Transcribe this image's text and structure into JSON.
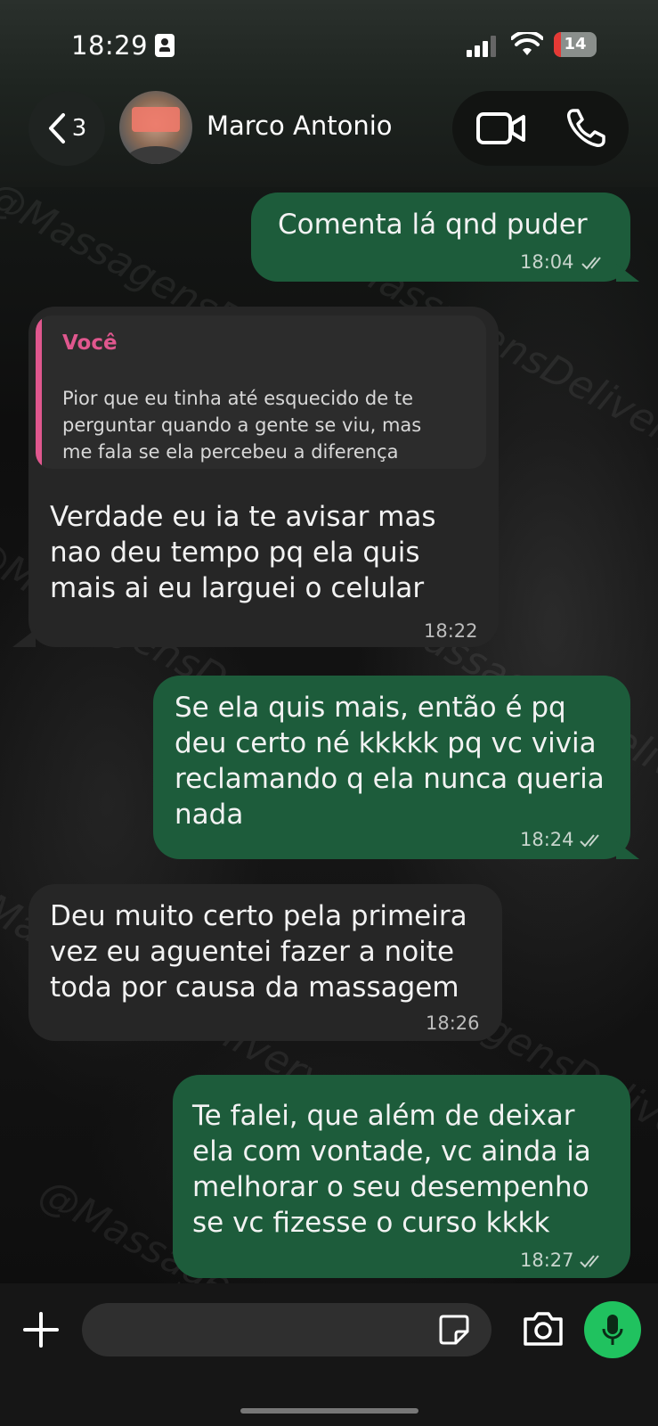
{
  "status_bar": {
    "time": "18:29",
    "battery_level": "14",
    "battery_color": "#e53935"
  },
  "header": {
    "back_count": "3",
    "contact_name": "Marco Antonio",
    "icons": [
      "chevron-left-icon",
      "video-call-icon",
      "phone-icon"
    ]
  },
  "messages": [
    {
      "direction": "out",
      "lines": [
        "Comenta lá qnd puder"
      ],
      "time": "18:04",
      "status": "read"
    },
    {
      "direction": "in",
      "reply_to": {
        "author": "Você",
        "lines": [
          "Pior que eu tinha até esquecido de te",
          "perguntar quando a gente se viu, mas",
          "me fala se ela percebeu a diferença"
        ]
      },
      "lines": [
        "Verdade eu ia te avisar mas",
        "nao deu tempo pq ela quis",
        "mais ai eu larguei o celular"
      ],
      "time": "18:22"
    },
    {
      "direction": "out",
      "lines": [
        "Se ela quis mais, então é pq",
        "deu certo né kkkkk pq vc vivia",
        "reclamando q ela nunca queria",
        "nada"
      ],
      "time": "18:24",
      "status": "read"
    },
    {
      "direction": "in",
      "lines": [
        "Deu muito certo pela primeira",
        "vez eu aguentei fazer a noite",
        "toda por causa da massagem"
      ],
      "time": "18:26"
    },
    {
      "direction": "out",
      "lines": [
        "Te falei, que além de deixar",
        "ela com vontade, vc ainda ia",
        "melhorar o seu desempenho",
        "se vc fizesse o curso kkkk"
      ],
      "time": "18:27",
      "status": "read"
    }
  ],
  "watermark": "@MassagensDelivery",
  "input_bar": {
    "placeholder": "",
    "icons": [
      "plus-icon",
      "sticker-icon",
      "camera-icon",
      "microphone-icon"
    ]
  },
  "colors": {
    "outgoing_bubble": "#1d5c3b",
    "incoming_bubble": "#262626",
    "reply_accent": "#e0578e",
    "mic_button": "#20c25f"
  }
}
